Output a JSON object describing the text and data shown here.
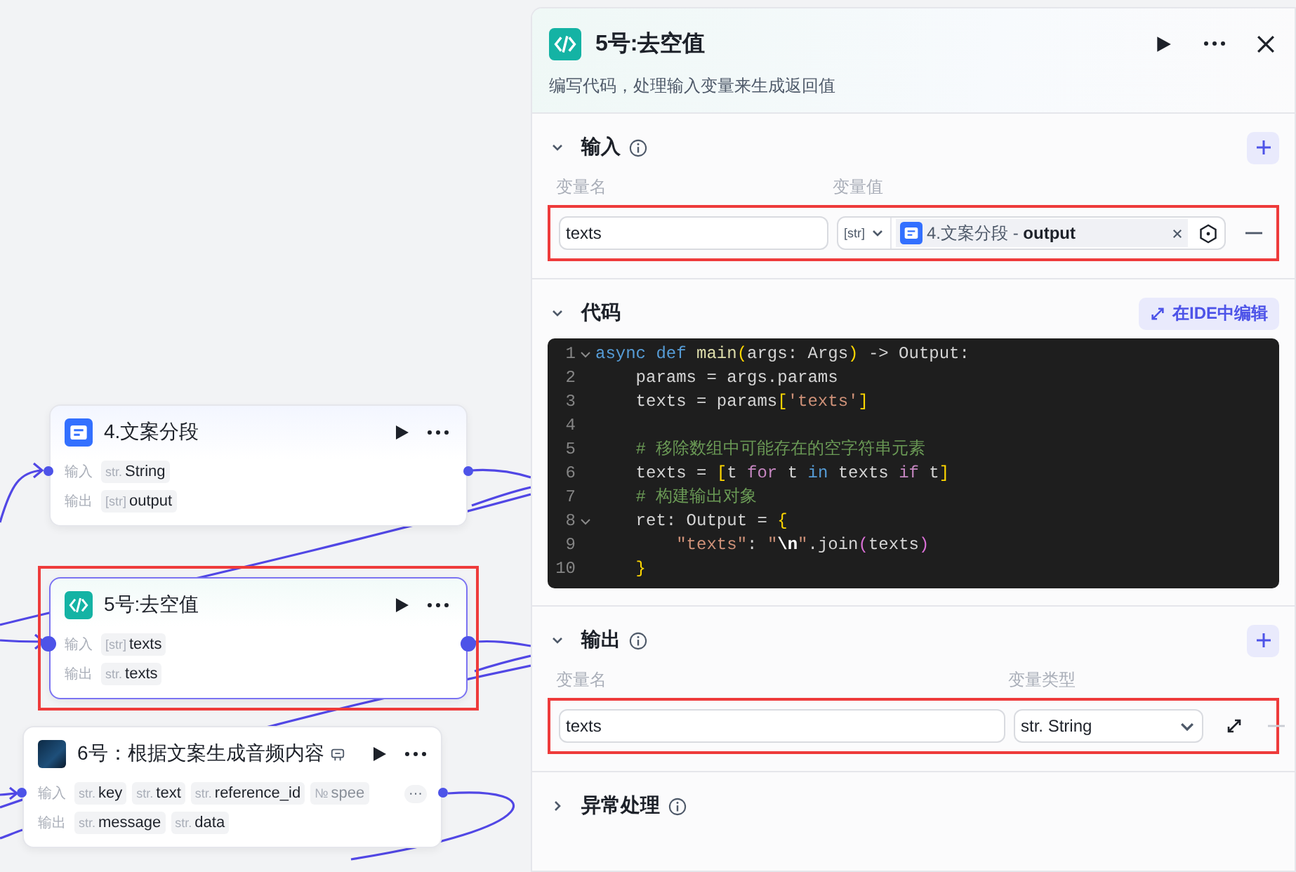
{
  "canvas": {
    "nodes": [
      {
        "kind": "text",
        "title": "4.文案分段",
        "selected": false,
        "highlighted": false,
        "inputs_label": "输入",
        "inputs": [
          {
            "type": "str.",
            "name": "String"
          }
        ],
        "outputs_label": "输出",
        "outputs": [
          {
            "type": "[str]",
            "name": "output"
          }
        ]
      },
      {
        "kind": "code",
        "title": "5号:去空值",
        "selected": true,
        "highlighted": true,
        "inputs_label": "输入",
        "inputs": [
          {
            "type": "[str]",
            "name": "texts"
          }
        ],
        "outputs_label": "输出",
        "outputs": [
          {
            "type": "str.",
            "name": "texts"
          }
        ]
      },
      {
        "kind": "plugin",
        "title": "6号：根据文案生成音频内容",
        "selected": false,
        "highlighted": false,
        "inputs_label": "输入",
        "inputs": [
          {
            "type": "str.",
            "name": "key",
            "faded": false
          },
          {
            "type": "str.",
            "name": "text",
            "faded": false
          },
          {
            "type": "str.",
            "name": "reference_id",
            "faded": false
          },
          {
            "type": "№",
            "name": "spee",
            "faded": true
          }
        ],
        "more_inputs": "···",
        "outputs_label": "输出",
        "outputs": [
          {
            "type": "str.",
            "name": "message"
          },
          {
            "type": "str.",
            "name": "data"
          }
        ]
      }
    ]
  },
  "panel": {
    "title": "5号:去空值",
    "description": "编写代码，处理输入变量来生成返回值",
    "input_section": {
      "title": "输入",
      "expanded": true,
      "column_labels": [
        "变量名",
        "变量值"
      ],
      "rows": [
        {
          "name": "texts",
          "type": "[str]",
          "value": "4.文案分段 - **output**",
          "highlighted": true
        }
      ]
    },
    "code_section": {
      "title": "代码",
      "expanded": true,
      "ide_button": "在IDE中编辑",
      "lines": [
        {
          "number": "1",
          "foldable": true,
          "tokens": [
            {
              "kind": "kw",
              "text": "async def"
            },
            {
              "kind": "fn",
              "text": " main"
            },
            {
              "kind": "br",
              "text": "("
            },
            {
              "kind": "plain",
              "text": "args: Args"
            },
            {
              "kind": "br",
              "text": ")"
            },
            {
              "kind": "plain",
              "text": " -> Output:"
            }
          ]
        },
        {
          "number": "2",
          "foldable": false,
          "tokens": [
            {
              "kind": "plain",
              "text": "    params = args.params"
            }
          ]
        },
        {
          "number": "3",
          "foldable": false,
          "tokens": [
            {
              "kind": "plain",
              "text": "    texts = params"
            },
            {
              "kind": "br",
              "text": "["
            },
            {
              "kind": "str",
              "text": "'texts'"
            },
            {
              "kind": "br",
              "text": "]"
            }
          ]
        },
        {
          "number": "4",
          "foldable": false
        },
        {
          "number": "5",
          "foldable": false,
          "tokens": [
            {
              "kind": "cm",
              "text": "    # 移除数组中可能存在的空字符串元素"
            }
          ]
        },
        {
          "number": "6",
          "foldable": false,
          "tokens": [
            {
              "kind": "plain",
              "text": "    texts = "
            },
            {
              "kind": "br",
              "text": "["
            },
            {
              "kind": "plain",
              "text": "t "
            },
            {
              "kind": "ctl",
              "text": "for"
            },
            {
              "kind": "plain",
              "text": " t "
            },
            {
              "kind": "kw",
              "text": "in"
            },
            {
              "kind": "plain",
              "text": " texts "
            },
            {
              "kind": "ctl",
              "text": "if"
            },
            {
              "kind": "plain",
              "text": " t"
            },
            {
              "kind": "br",
              "text": "]"
            }
          ]
        },
        {
          "number": "7",
          "foldable": false,
          "tokens": [
            {
              "kind": "cm",
              "text": "    # 构建输出对象"
            }
          ]
        },
        {
          "number": "8",
          "foldable": true,
          "tokens": [
            {
              "kind": "plain",
              "text": "    ret: Output = "
            },
            {
              "kind": "br",
              "text": "{"
            }
          ]
        },
        {
          "number": "9",
          "foldable": false,
          "tokens": [
            {
              "kind": "str",
              "text": "        \"texts\""
            },
            {
              "kind": "plain",
              "text": ": "
            },
            {
              "kind": "str",
              "text": "\""
            },
            {
              "kind": "esc",
              "text": "\\n"
            },
            {
              "kind": "str",
              "text": "\""
            },
            {
              "kind": "plain",
              "text": ".join"
            },
            {
              "kind": "br2",
              "text": "("
            },
            {
              "kind": "plain",
              "text": "texts"
            },
            {
              "kind": "br2",
              "text": ")"
            }
          ]
        },
        {
          "number": "10",
          "foldable": false,
          "tokens": [
            {
              "kind": "br",
              "text": "    }"
            }
          ]
        }
      ]
    },
    "output_section": {
      "title": "输出",
      "expanded": true,
      "column_labels": [
        "变量名",
        "变量类型"
      ],
      "rows": [
        {
          "name": "texts",
          "type": "str. String",
          "highlighted": true
        }
      ]
    },
    "error_section": {
      "title": "异常处理",
      "expanded": false
    }
  }
}
